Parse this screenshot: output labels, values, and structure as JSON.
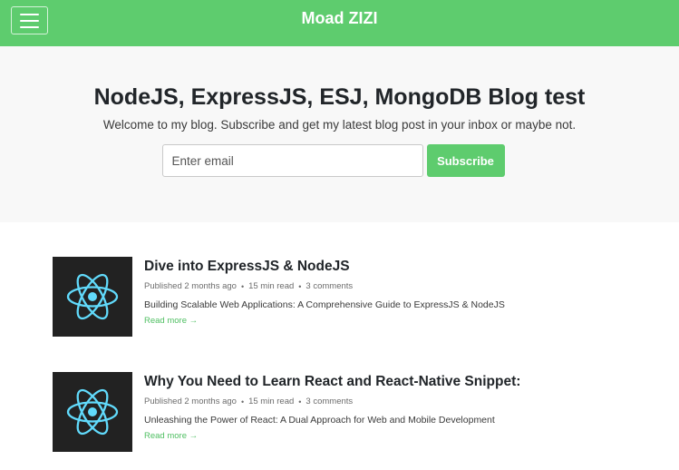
{
  "navbar": {
    "brand": "Moad ZIZI",
    "menu_icon": "hamburger-menu-icon"
  },
  "hero": {
    "title": "NodeJS, ExpressJS, ESJ, MongoDB Blog test",
    "subtitle": "Welcome to my blog. Subscribe and get my latest blog post in your inbox or maybe not.",
    "email_placeholder": "Enter email",
    "email_value": "",
    "subscribe_label": "Subscribe"
  },
  "colors": {
    "accent": "#5ecc6e",
    "hero_bg": "#f8f8f8",
    "thumb_bg": "#222222",
    "react_logo": "#61dafb"
  },
  "posts": [
    {
      "thumbnail_icon": "react-logo-icon",
      "title": "Dive into ExpressJS & NodeJS",
      "published": "Published 2 months ago",
      "read_time": "15 min read",
      "comments": "3 comments",
      "excerpt": "Building Scalable Web Applications: A Comprehensive Guide to ExpressJS & NodeJS",
      "read_more": "Read more →"
    },
    {
      "thumbnail_icon": "react-logo-icon",
      "title": "Why You Need to Learn React and React-Native Snippet:",
      "published": "Published 2 months ago",
      "read_time": "15 min read",
      "comments": "3 comments",
      "excerpt": "Unleashing the Power of React: A Dual Approach for Web and Mobile Development",
      "read_more": "Read more →"
    }
  ]
}
